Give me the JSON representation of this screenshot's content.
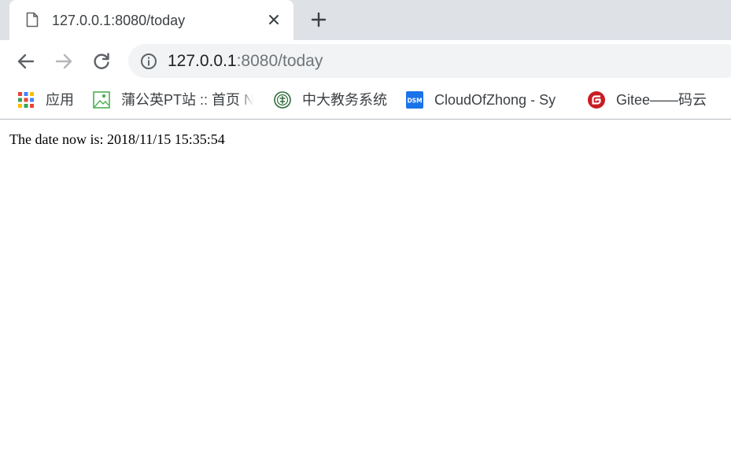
{
  "tab": {
    "title": "127.0.0.1:8080/today",
    "icon": "document-icon",
    "close_icon": "close-icon"
  },
  "new_tab_icon": "plus-icon",
  "toolbar": {
    "back_icon": "back-arrow-icon",
    "forward_icon": "forward-arrow-icon",
    "reload_icon": "reload-icon",
    "site_info_icon": "info-icon",
    "url_host": "127.0.0.1",
    "url_rest": ":8080/today"
  },
  "bookmarks": [
    {
      "label": "应用",
      "icon": "apps-grid-icon"
    },
    {
      "label": "蒲公英PT站 :: 首页 N",
      "icon": "image-placeholder-icon"
    },
    {
      "label": "中大教务系统",
      "icon": "university-seal-icon"
    },
    {
      "label": "CloudOfZhong - Sy",
      "icon": "dsm-icon",
      "icon_text": "DSM"
    },
    {
      "label": "Gitee——码云",
      "icon": "gitee-icon"
    }
  ],
  "page": {
    "text": "The date now is: 2018/11/15 15:35:54"
  },
  "colors": {
    "tabstrip": "#dee1e6",
    "omnibox": "#f1f3f4",
    "dsm_blue": "#1a73e8",
    "gitee_red": "#c71d23",
    "sysu_green": "#2e6b3a"
  }
}
